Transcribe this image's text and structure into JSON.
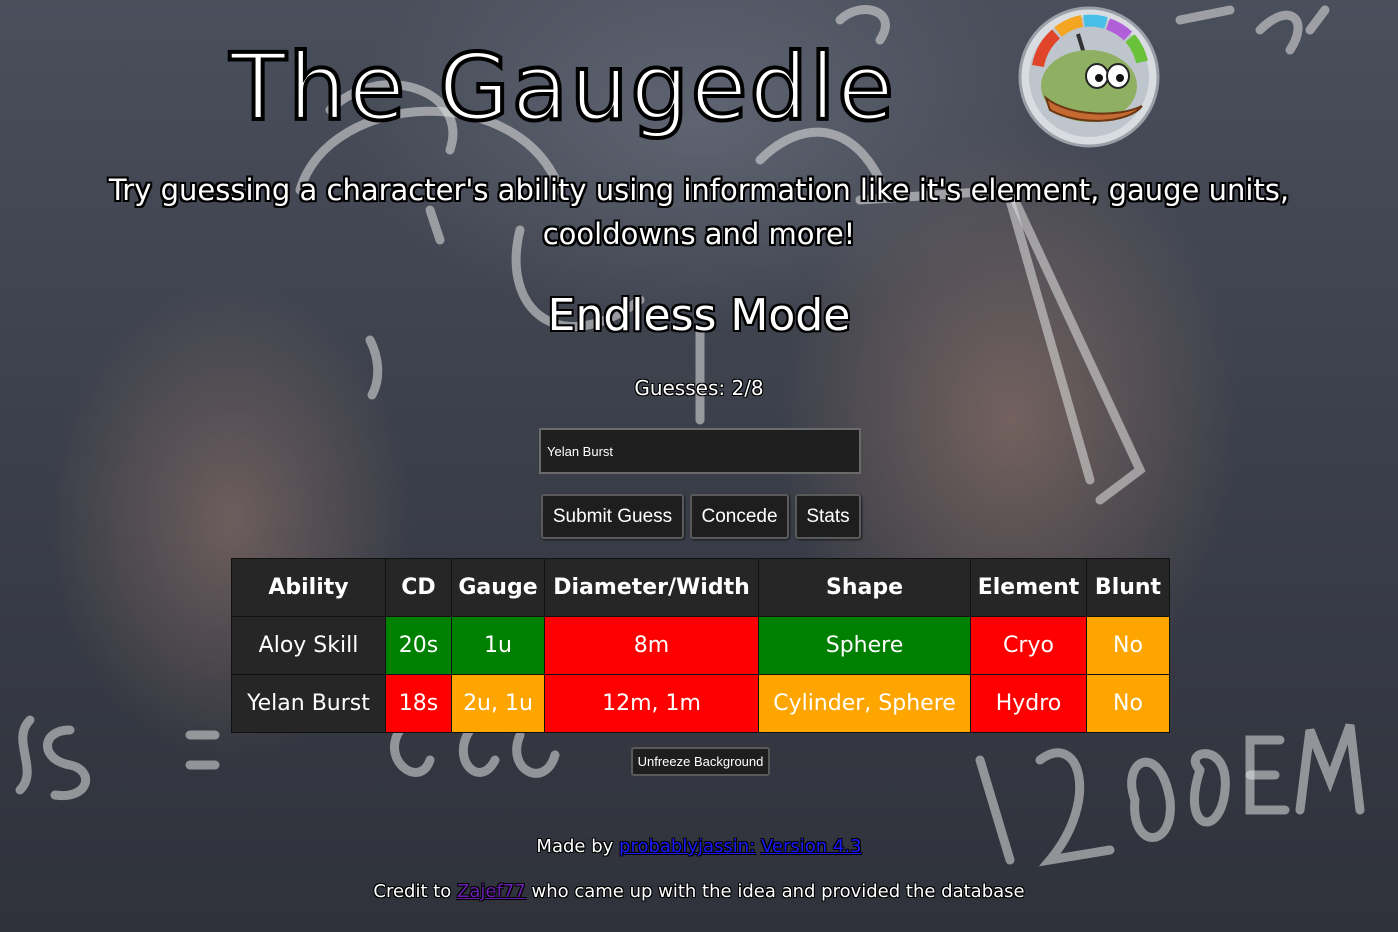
{
  "header": {
    "title": "The Gaugedle",
    "subtitle": "Try guessing a character's ability using information like it's element, gauge units, cooldowns and more!"
  },
  "mode": {
    "title": "Endless Mode",
    "guesses_label": "Guesses: 2/8"
  },
  "guess_input": {
    "value": "Yelan Burst"
  },
  "buttons": {
    "submit": "Submit Guess",
    "concede": "Concede",
    "stats": "Stats",
    "unfreeze": "Unfreeze Background"
  },
  "table": {
    "headers": [
      "Ability",
      "CD",
      "Gauge",
      "Diameter/Width",
      "Shape",
      "Element",
      "Blunt"
    ],
    "rows": [
      {
        "ability": "Aloy Skill",
        "cd": {
          "text": "20s",
          "status": "correct"
        },
        "gauge": {
          "text": "1u",
          "status": "correct"
        },
        "diameter": {
          "text": "8m",
          "status": "wrong"
        },
        "shape": {
          "text": "Sphere",
          "status": "correct"
        },
        "element": {
          "text": "Cryo",
          "status": "wrong"
        },
        "blunt": {
          "text": "No",
          "status": "partial"
        }
      },
      {
        "ability": "Yelan Burst",
        "cd": {
          "text": "18s",
          "status": "wrong"
        },
        "gauge": {
          "text": "2u, 1u",
          "status": "partial"
        },
        "diameter": {
          "text": "12m, 1m",
          "status": "wrong"
        },
        "shape": {
          "text": "Cylinder, Sphere",
          "status": "partial"
        },
        "element": {
          "text": "Hydro",
          "status": "wrong"
        },
        "blunt": {
          "text": "No",
          "status": "partial"
        }
      }
    ]
  },
  "status_colors": {
    "correct": "#008000",
    "wrong": "#ff0000",
    "partial": "#ffa500"
  },
  "footer": {
    "made_by_prefix": "Made by",
    "author_link": "probablyjassin:",
    "version_link": "Version 4.3",
    "credit_prefix": "Credit to",
    "credit_link": "Zajef77",
    "credit_suffix": "who came up with the idea and provided the database"
  },
  "icons": {
    "logo": "gauge-frog-logo-icon"
  }
}
